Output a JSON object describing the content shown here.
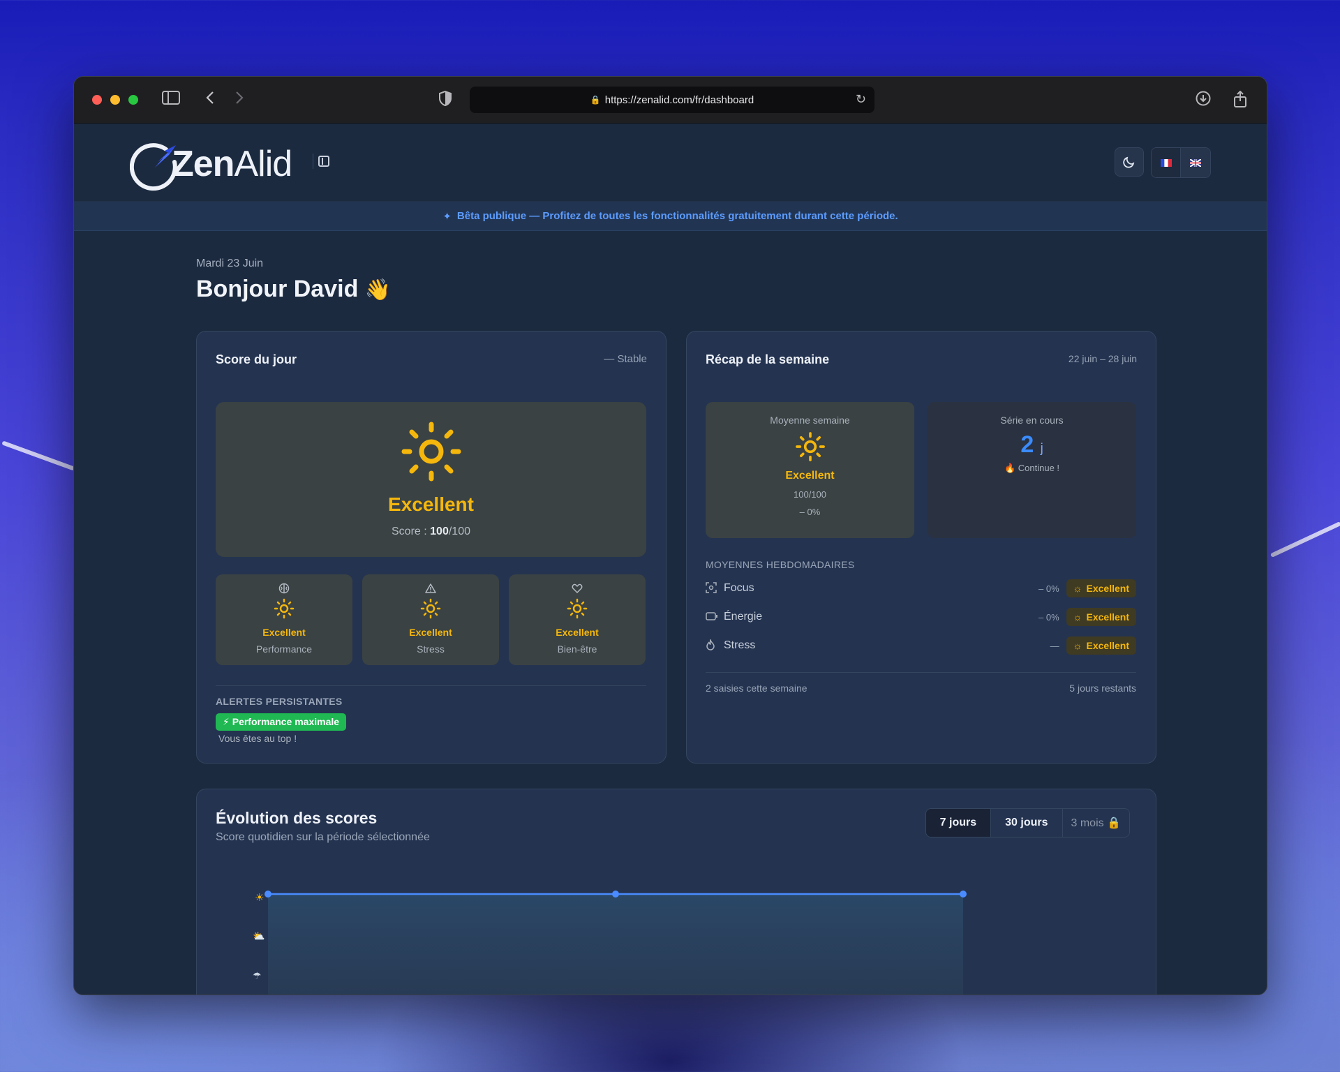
{
  "browser": {
    "url": "https://zenalid.com/fr/dashboard"
  },
  "app": {
    "logo_bold": "Zen",
    "logo_light": "Alid",
    "lang_fr": "FR",
    "lang_en": "EN"
  },
  "banner": {
    "text": "Bêta publique — Profitez de toutes les fonctionnalités gratuitement durant cette période."
  },
  "page": {
    "date": "Mardi 23 Juin",
    "greeting": "Bonjour David",
    "wave": "👋"
  },
  "score_card": {
    "title": "Score du jour",
    "trend": "Stable",
    "label": "Excellent",
    "score_prefix": "Score : ",
    "score_value": "100",
    "score_suffix": "/100",
    "tiles": [
      {
        "label": "Excellent",
        "sub": "Performance",
        "icon": "brain-icon"
      },
      {
        "label": "Excellent",
        "sub": "Stress",
        "icon": "warning-icon"
      },
      {
        "label": "Excellent",
        "sub": "Bien-être",
        "icon": "heart-icon"
      }
    ],
    "alerts_caption": "ALERTES PERSISTANTES",
    "alert_badge": "Performance maximale",
    "alert_text": "Vous êtes au top !"
  },
  "recap_card": {
    "title": "Récap de la semaine",
    "range": "22 juin – 28 juin",
    "avg_caption": "Moyenne semaine",
    "avg_label": "Excellent",
    "avg_score": "100/100",
    "avg_delta": "– 0%",
    "streak_caption": "Série en cours",
    "streak_value": "2",
    "streak_unit": "j",
    "streak_note": "🔥 Continue !",
    "weekly_caption": "MOYENNES HEBDOMADAIRES",
    "weekly": [
      {
        "name": "Focus",
        "delta": "– 0%",
        "label": "Excellent"
      },
      {
        "name": "Énergie",
        "delta": "– 0%",
        "label": "Excellent"
      },
      {
        "name": "Stress",
        "delta": "—",
        "label": "Excellent"
      }
    ],
    "entries": "2 saisies cette semaine",
    "remaining": "5 jours restants"
  },
  "chart_card": {
    "title": "Évolution des scores",
    "subtitle": "Score quotidien sur la période sélectionnée",
    "tabs": [
      "7 jours",
      "30 jours",
      "3 mois 🔒"
    ],
    "active_tab": "7 jours"
  },
  "chart_data": {
    "type": "area",
    "title": "Évolution des scores",
    "x": [
      0,
      1,
      2
    ],
    "series": [
      {
        "values": [
          100,
          100,
          100
        ]
      }
    ],
    "y_levels": [
      "sun",
      "sun-cloud",
      "rain-cloud"
    ],
    "ylim": [
      0,
      100
    ],
    "colors": {
      "line": "#4a8cff"
    }
  },
  "colors": {
    "accent": "#3b8cff",
    "excellent": "#f5b70c",
    "alert_green": "#1fb852"
  }
}
